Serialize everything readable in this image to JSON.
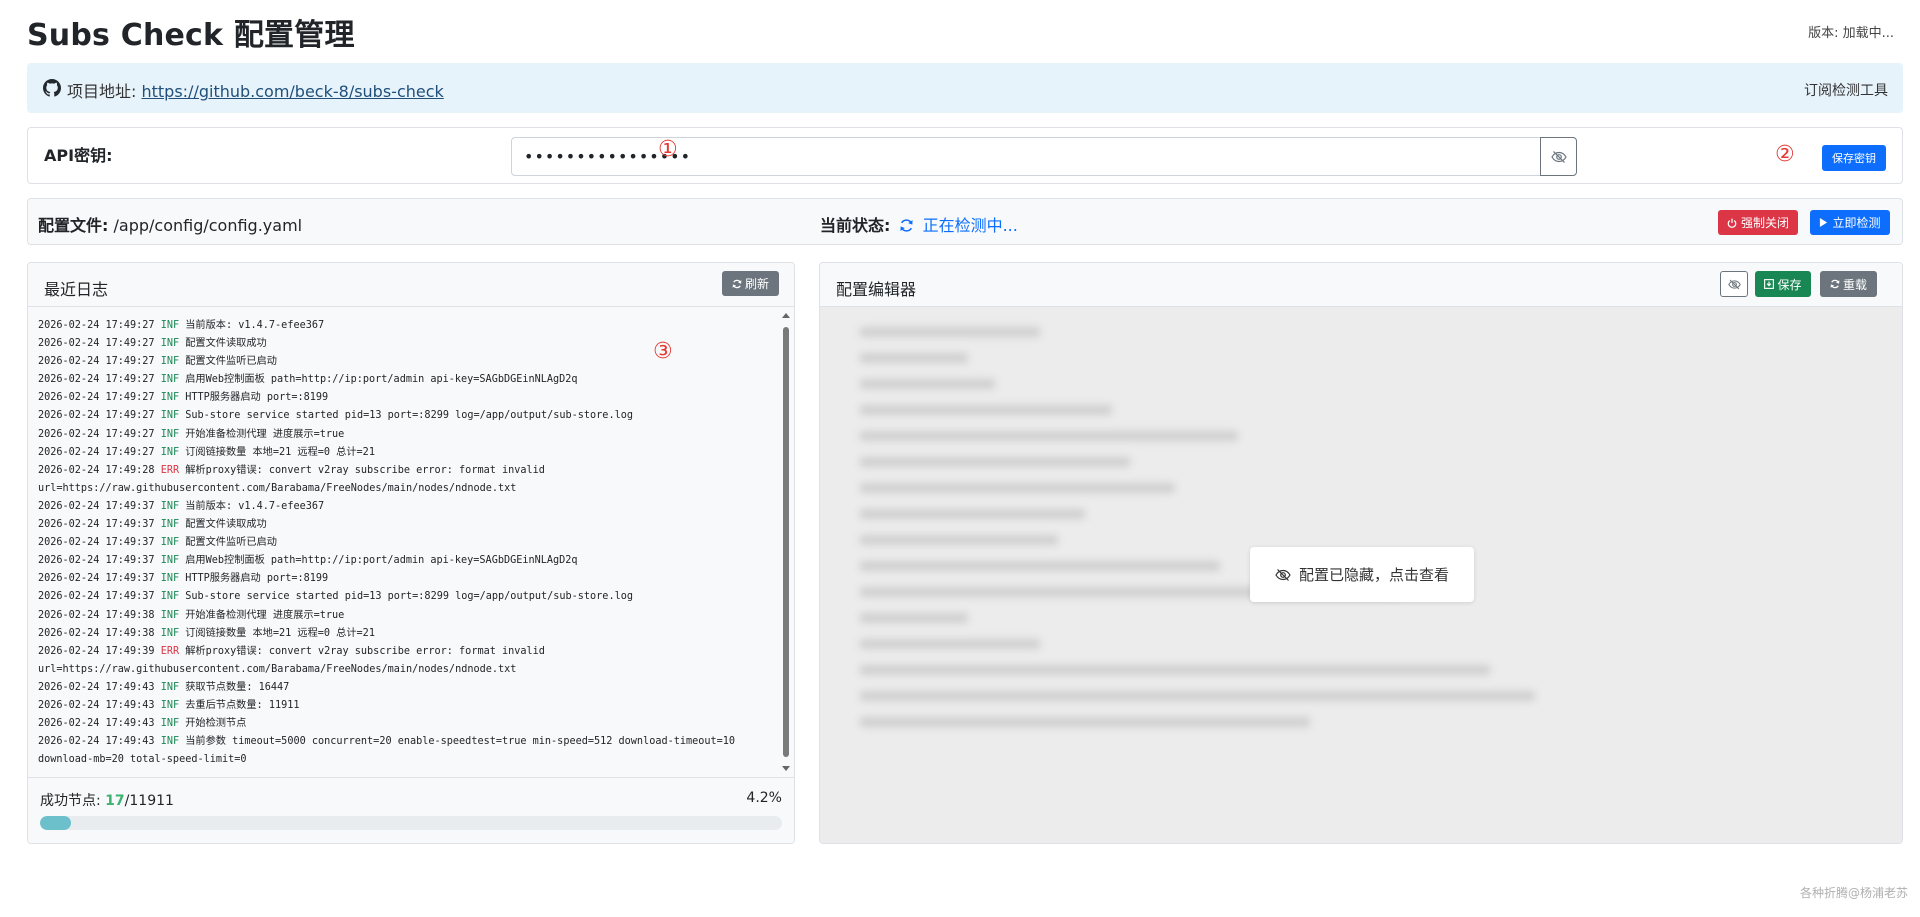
{
  "header": {
    "title": "Subs Check 配置管理",
    "version": "版本: 加载中..."
  },
  "project": {
    "label": "项目地址: ",
    "url": "https://github.com/beck-8/subs-check",
    "tool_label": "订阅检测工具"
  },
  "api": {
    "label": "API密钥:",
    "value": "••••••••••••••••",
    "save_label": "保存密钥",
    "annotation_1": "①",
    "annotation_2": "②"
  },
  "status": {
    "config_label": "配置文件:",
    "config_path": "/app/config/config.yaml",
    "state_label": "当前状态:",
    "state_value": "正在检测中...",
    "force_close_label": "强制关闭",
    "check_now_label": "立即检测"
  },
  "log_panel": {
    "title": "最近日志",
    "refresh_label": "刷新",
    "annotation_3": "③",
    "lines": [
      {
        "time": "2026-02-24 17:49:27",
        "level": "INF",
        "msg": "当前版本: v1.4.7-efee367"
      },
      {
        "time": "2026-02-24 17:49:27",
        "level": "INF",
        "msg": "配置文件读取成功"
      },
      {
        "time": "2026-02-24 17:49:27",
        "level": "INF",
        "msg": "配置文件监听已启动"
      },
      {
        "time": "2026-02-24 17:49:27",
        "level": "INF",
        "msg": "启用Web控制面板 path=http://ip:port/admin api-key=SAGbDGEinNLAgD2q"
      },
      {
        "time": "2026-02-24 17:49:27",
        "level": "INF",
        "msg": "HTTP服务器启动 port=:8199"
      },
      {
        "time": "2026-02-24 17:49:27",
        "level": "INF",
        "msg": "Sub-store service started pid=13 port=:8299 log=/app/output/sub-store.log"
      },
      {
        "time": "2026-02-24 17:49:27",
        "level": "INF",
        "msg": "开始准备检测代理 进度展示=true"
      },
      {
        "time": "2026-02-24 17:49:27",
        "level": "INF",
        "msg": "订阅链接数量 本地=21 远程=0 总计=21"
      },
      {
        "time": "2026-02-24 17:49:28",
        "level": "ERR",
        "msg": "解析proxy错误: convert v2ray subscribe error: format invalid"
      },
      {
        "time": "",
        "level": "",
        "msg": "url=https://raw.githubusercontent.com/Barabama/FreeNodes/main/nodes/ndnode.txt"
      },
      {
        "time": "2026-02-24 17:49:37",
        "level": "INF",
        "msg": "当前版本: v1.4.7-efee367"
      },
      {
        "time": "2026-02-24 17:49:37",
        "level": "INF",
        "msg": "配置文件读取成功"
      },
      {
        "time": "2026-02-24 17:49:37",
        "level": "INF",
        "msg": "配置文件监听已启动"
      },
      {
        "time": "2026-02-24 17:49:37",
        "level": "INF",
        "msg": "启用Web控制面板 path=http://ip:port/admin api-key=SAGbDGEinNLAgD2q"
      },
      {
        "time": "2026-02-24 17:49:37",
        "level": "INF",
        "msg": "HTTP服务器启动 port=:8199"
      },
      {
        "time": "2026-02-24 17:49:37",
        "level": "INF",
        "msg": "Sub-store service started pid=13 port=:8299 log=/app/output/sub-store.log"
      },
      {
        "time": "2026-02-24 17:49:38",
        "level": "INF",
        "msg": "开始准备检测代理 进度展示=true"
      },
      {
        "time": "2026-02-24 17:49:38",
        "level": "INF",
        "msg": "订阅链接数量 本地=21 远程=0 总计=21"
      },
      {
        "time": "2026-02-24 17:49:39",
        "level": "ERR",
        "msg": "解析proxy错误: convert v2ray subscribe error: format invalid"
      },
      {
        "time": "",
        "level": "",
        "msg": "url=https://raw.githubusercontent.com/Barabama/FreeNodes/main/nodes/ndnode.txt"
      },
      {
        "time": "2026-02-24 17:49:43",
        "level": "INF",
        "msg": "获取节点数量: 16447"
      },
      {
        "time": "2026-02-24 17:49:43",
        "level": "INF",
        "msg": "去重后节点数量: 11911"
      },
      {
        "time": "2026-02-24 17:49:43",
        "level": "INF",
        "msg": "开始检测节点"
      },
      {
        "time": "2026-02-24 17:49:43",
        "level": "INF",
        "msg": "当前参数 timeout=5000 concurrent=20 enable-speedtest=true min-speed=512 download-timeout=10"
      },
      {
        "time": "",
        "level": "",
        "msg": "download-mb=20 total-speed-limit=0"
      }
    ],
    "success_label": "成功节点: ",
    "success_count": "17",
    "total_count": "/11911",
    "percent_text": "4.2%",
    "progress_fraction": 0.042
  },
  "config_panel": {
    "title": "配置编辑器",
    "save_label": "保存",
    "reload_label": "重载",
    "hidden_msg": "配置已隐藏，点击查看"
  },
  "footer": {
    "note": "各种折腾@杨浦老苏"
  },
  "colors": {
    "primary": "#0d6efd",
    "danger": "#dc3545",
    "success": "#198754",
    "secondary": "#6c757d",
    "annotation": "#e53935"
  }
}
